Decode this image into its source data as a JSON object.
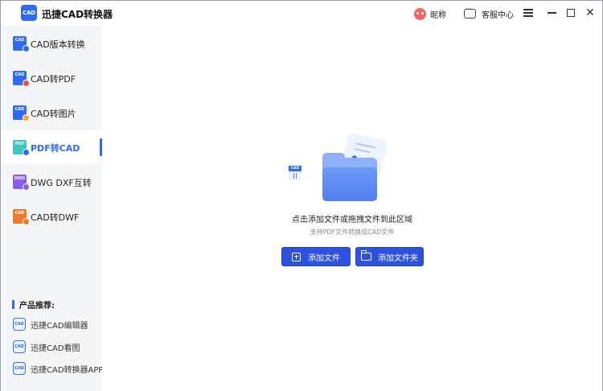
{
  "app": {
    "logo_text": "CAD",
    "title": "迅捷CAD转换器"
  },
  "header": {
    "nickname": "昵称",
    "service": "客服中心"
  },
  "sidebar": {
    "items": [
      {
        "label": "CAD版本转换",
        "icon_text": "CAD",
        "color": "#2f6bf2"
      },
      {
        "label": "CAD转PDF",
        "icon_text": "CAD",
        "color": "#2f6bf2"
      },
      {
        "label": "CAD转图片",
        "icon_text": "CAD",
        "color": "#2f6bf2"
      },
      {
        "label": "PDF转CAD",
        "icon_text": "PDF",
        "color": "#3ec7c2",
        "active": true
      },
      {
        "label": "DWG DXF互转",
        "icon_text": "DWG",
        "color": "#8a5cf0"
      },
      {
        "label": "CAD转DWF",
        "icon_text": "CAD",
        "color": "#f07a2a"
      }
    ],
    "recommend_title": "产品推荐:",
    "recommend": [
      {
        "label": "迅捷CAD编辑器",
        "icon_text": "CAD"
      },
      {
        "label": "迅捷CAD看图",
        "icon_text": "CAD"
      },
      {
        "label": "迅捷CAD转换器APP",
        "icon_text": "CAD"
      }
    ]
  },
  "main": {
    "mini_icon_text": "CAD",
    "drop_text": "点击添加文件或拖拽文件到此区域",
    "sub_text": "支持PDF文件转换成CAD文件",
    "add_file": "添加文件",
    "add_folder": "添加文件夹"
  },
  "colors": {
    "accent": "#2f6bf2",
    "button": "#2e52e0"
  }
}
